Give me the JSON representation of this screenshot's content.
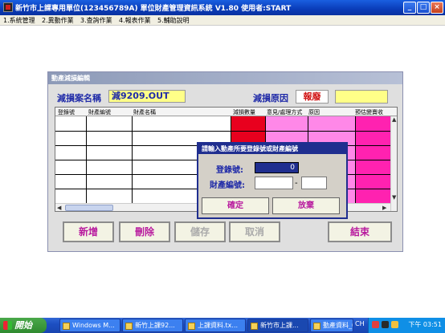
{
  "window": {
    "title": "新竹市上課專用單位(123456789A)     單位財產管理資訊系統  V1.80          使用者:START"
  },
  "menu": [
    {
      "label": "1.系統管理"
    },
    {
      "label": "2.異動作業"
    },
    {
      "label": "3.查詢作業"
    },
    {
      "label": "4.報表作業"
    },
    {
      "label": "5.輔助說明"
    }
  ],
  "dialog": {
    "title": "動產減損編輯",
    "case_label": "減損案名稱",
    "case_value": "減9209.OUT",
    "reason_label": "減損原因",
    "reason_value": "報廢",
    "grid": {
      "columns": [
        "登錄號",
        "財產編號",
        "財產名稱",
        "減損數量",
        "意見/處理方式",
        "原因",
        "預估變賣收"
      ]
    },
    "buttons": {
      "add": "新增",
      "delete": "刪除",
      "save": "儲存",
      "cancel": "取消",
      "finish": "結束"
    }
  },
  "modal": {
    "title": "請輸入動產所要登錄號或財產編號",
    "reg_label": "登錄號:",
    "reg_value": "0",
    "prop_label": "財產編號:",
    "dash": "-",
    "ok": "確定",
    "abandon": "放棄"
  },
  "taskbar": {
    "start": "開始",
    "tasks": [
      {
        "label": "Windows M..."
      },
      {
        "label": "新竹上課92..."
      },
      {
        "label": "上課資料.tx..."
      },
      {
        "label": "新竹市上課..."
      },
      {
        "label": "動產資料_0..."
      }
    ],
    "ime": "CH",
    "clock": "下午 03:51"
  },
  "colors": {
    "accent_red": "#e8001e",
    "accent_pink": "#ff88e8",
    "accent_magenta": "#ff22b0",
    "highlight_yellow": "#ffff88",
    "label_blue": "#1f2aa8"
  }
}
